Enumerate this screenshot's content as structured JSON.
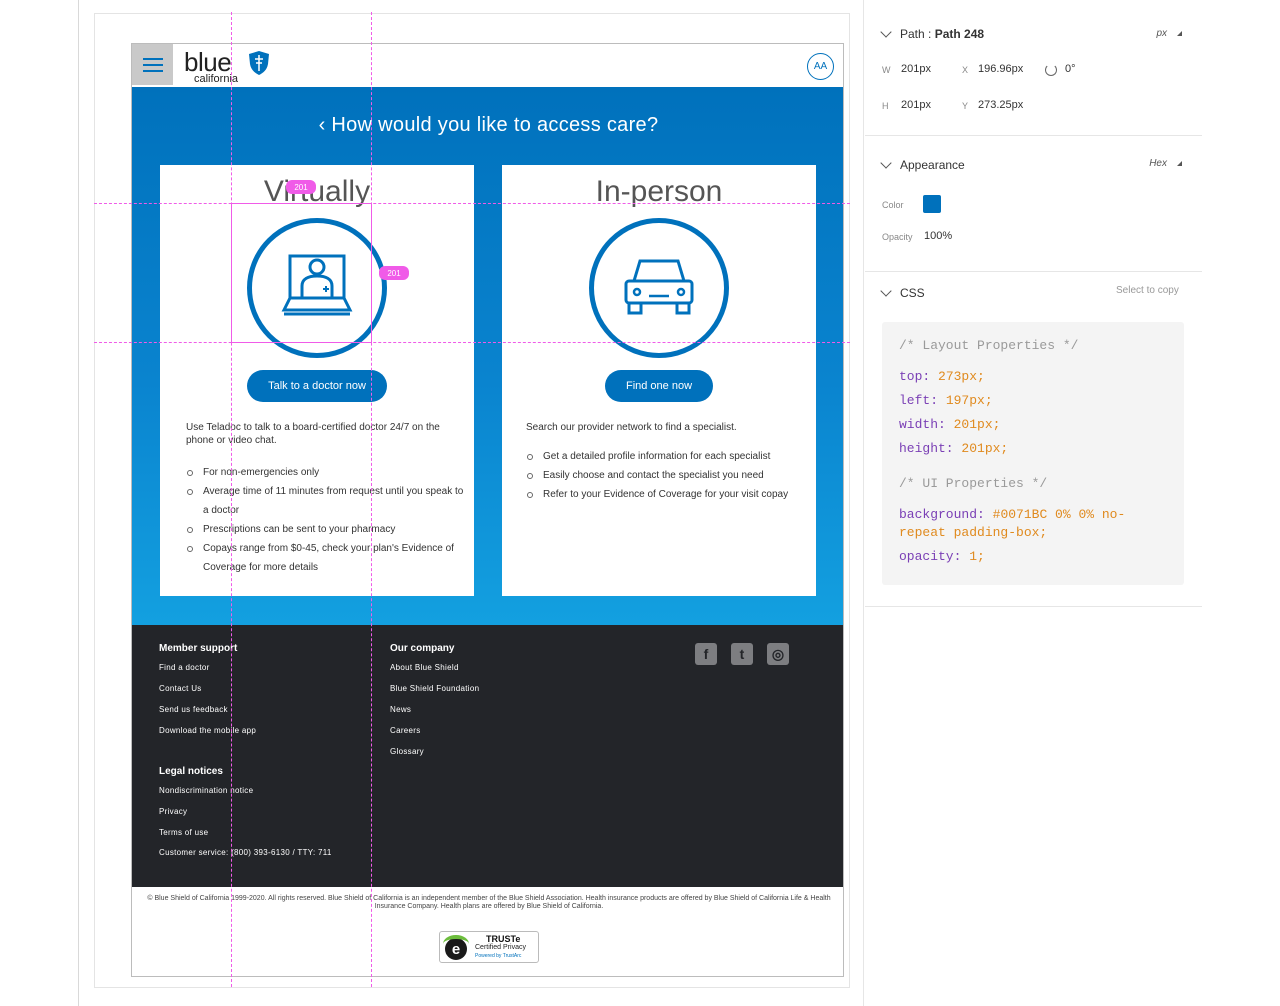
{
  "header": {
    "logo_word": "blue",
    "logo_sub": "california",
    "aa_label": "AA"
  },
  "hero": {
    "back_glyph": "‹",
    "title": "How would you like to access care?"
  },
  "cards": {
    "virtual": {
      "title": "Virtually",
      "icon": "doctor-laptop-icon",
      "button": "Talk to a doctor now",
      "description": "Use Teladoc to talk to a board-certified doctor 24/7 on the phone or video chat.",
      "bullets": [
        "For non-emergencies only",
        "Average time of 11 minutes from request until you speak to a doctor",
        "Prescriptions can be sent to your pharmacy",
        "Copays range from $0-45, check your plan's Evidence of Coverage for more details"
      ]
    },
    "inperson": {
      "title": "In-person",
      "icon": "car-icon",
      "button": "Find one now",
      "description": "Search our provider network to find a specialist.",
      "bullets": [
        "Get a detailed profile information for each specialist",
        "Easily choose and contact the specialist you need",
        "Refer to your Evidence of Coverage for your visit copay"
      ]
    }
  },
  "footer": {
    "member_support": {
      "heading": "Member support",
      "links": [
        "Find a doctor",
        "Contact Us",
        "Send us feedback",
        "Download the mobile app"
      ]
    },
    "our_company": {
      "heading": "Our company",
      "links": [
        "About Blue Shield",
        "Blue Shield Foundation",
        "News",
        "Careers",
        "Glossary"
      ]
    },
    "legal": {
      "heading": "Legal notices",
      "links": [
        "Nondiscrimination notice",
        "Privacy",
        "Terms of use"
      ]
    },
    "customer_service": "Customer service:  (800) 393-6130  /   TTY: 711",
    "social_icons": [
      "facebook-icon",
      "twitter-icon",
      "instagram-icon"
    ]
  },
  "copyright": "© Blue Shield of California 1999-2020. All rights reserved. Blue Shield of California is an independent member of the Blue Shield Association. Health insurance products are offered by Blue Shield of California Life & Health Insurance Company. Health plans are offered by Blue Shield of California.",
  "truste": {
    "line1": "TRUSTe",
    "line2": "Certified Privacy",
    "line3": "Powered by TrustArc"
  },
  "selection": {
    "width_badge": "201",
    "height_badge": "201"
  },
  "inspector": {
    "path": {
      "label": "Path",
      "name": "Path 248",
      "unit": "px",
      "w_label": "W",
      "w_value": "201px",
      "x_label": "X",
      "x_value": "196.96px",
      "rotation": "0°",
      "h_label": "H",
      "h_value": "201px",
      "y_label": "Y",
      "y_value": "273.25px"
    },
    "appearance": {
      "heading": "Appearance",
      "mode": "Hex",
      "color_label": "Color",
      "color_value": "#0071BC",
      "opacity_label": "Opacity",
      "opacity_value": "100%"
    },
    "css": {
      "heading": "CSS",
      "copy_hint": "Select to copy",
      "layout_comment": "/* Layout Properties */",
      "top_key": "top:",
      "top_val": "273px;",
      "left_key": "left:",
      "left_val": "197px;",
      "width_key": "width:",
      "width_val": "201px;",
      "height_key": "height:",
      "height_val": "201px;",
      "ui_comment": "/* UI Properties */",
      "bg_key": "background:",
      "bg_val": "#0071BC 0% 0% no-",
      "bg_val2": "repeat padding-box;",
      "opacity_key": "opacity:",
      "opacity_val": "1;"
    }
  },
  "colors": {
    "brand": "#0071bc",
    "footer_bg": "#232529",
    "guide": "#f05be8"
  }
}
